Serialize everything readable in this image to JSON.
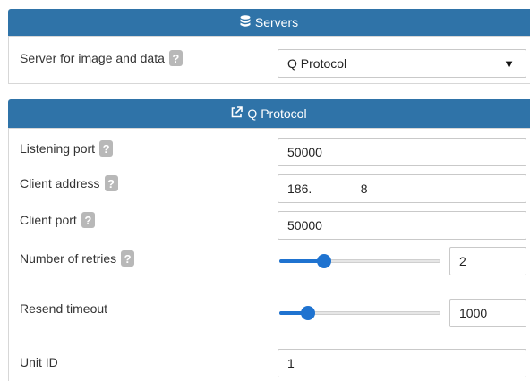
{
  "servers_panel": {
    "title": "Servers",
    "icon": "database-icon",
    "server_select": {
      "label": "Server for image and data",
      "value": "Q Protocol"
    }
  },
  "protocol_panel": {
    "title": "Q Protocol",
    "icon": "external-link-icon",
    "listening_port": {
      "label": "Listening port",
      "value": "50000"
    },
    "client_address": {
      "label": "Client address",
      "value": "186.              8"
    },
    "client_port": {
      "label": "Client port",
      "value": "50000"
    },
    "retries": {
      "label": "Number of retries",
      "value": "2",
      "fraction": 0.28
    },
    "resend_timeout": {
      "label": "Resend timeout",
      "value": "1000",
      "fraction": 0.18
    },
    "unit_id": {
      "label": "Unit ID",
      "value": "1"
    }
  },
  "help_glyph": "?",
  "dropdown_caret": "▼"
}
